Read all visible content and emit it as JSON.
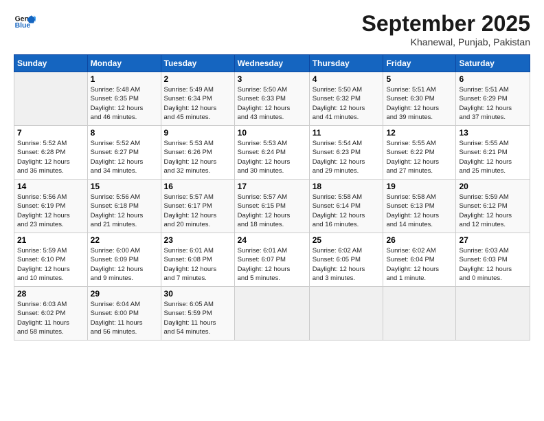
{
  "logo": {
    "line1": "General",
    "line2": "Blue"
  },
  "title": "September 2025",
  "subtitle": "Khanewal, Punjab, Pakistan",
  "days_header": [
    "Sunday",
    "Monday",
    "Tuesday",
    "Wednesday",
    "Thursday",
    "Friday",
    "Saturday"
  ],
  "weeks": [
    [
      {
        "day": "",
        "info": ""
      },
      {
        "day": "1",
        "info": "Sunrise: 5:48 AM\nSunset: 6:35 PM\nDaylight: 12 hours\nand 46 minutes."
      },
      {
        "day": "2",
        "info": "Sunrise: 5:49 AM\nSunset: 6:34 PM\nDaylight: 12 hours\nand 45 minutes."
      },
      {
        "day": "3",
        "info": "Sunrise: 5:50 AM\nSunset: 6:33 PM\nDaylight: 12 hours\nand 43 minutes."
      },
      {
        "day": "4",
        "info": "Sunrise: 5:50 AM\nSunset: 6:32 PM\nDaylight: 12 hours\nand 41 minutes."
      },
      {
        "day": "5",
        "info": "Sunrise: 5:51 AM\nSunset: 6:30 PM\nDaylight: 12 hours\nand 39 minutes."
      },
      {
        "day": "6",
        "info": "Sunrise: 5:51 AM\nSunset: 6:29 PM\nDaylight: 12 hours\nand 37 minutes."
      }
    ],
    [
      {
        "day": "7",
        "info": "Sunrise: 5:52 AM\nSunset: 6:28 PM\nDaylight: 12 hours\nand 36 minutes."
      },
      {
        "day": "8",
        "info": "Sunrise: 5:52 AM\nSunset: 6:27 PM\nDaylight: 12 hours\nand 34 minutes."
      },
      {
        "day": "9",
        "info": "Sunrise: 5:53 AM\nSunset: 6:26 PM\nDaylight: 12 hours\nand 32 minutes."
      },
      {
        "day": "10",
        "info": "Sunrise: 5:53 AM\nSunset: 6:24 PM\nDaylight: 12 hours\nand 30 minutes."
      },
      {
        "day": "11",
        "info": "Sunrise: 5:54 AM\nSunset: 6:23 PM\nDaylight: 12 hours\nand 29 minutes."
      },
      {
        "day": "12",
        "info": "Sunrise: 5:55 AM\nSunset: 6:22 PM\nDaylight: 12 hours\nand 27 minutes."
      },
      {
        "day": "13",
        "info": "Sunrise: 5:55 AM\nSunset: 6:21 PM\nDaylight: 12 hours\nand 25 minutes."
      }
    ],
    [
      {
        "day": "14",
        "info": "Sunrise: 5:56 AM\nSunset: 6:19 PM\nDaylight: 12 hours\nand 23 minutes."
      },
      {
        "day": "15",
        "info": "Sunrise: 5:56 AM\nSunset: 6:18 PM\nDaylight: 12 hours\nand 21 minutes."
      },
      {
        "day": "16",
        "info": "Sunrise: 5:57 AM\nSunset: 6:17 PM\nDaylight: 12 hours\nand 20 minutes."
      },
      {
        "day": "17",
        "info": "Sunrise: 5:57 AM\nSunset: 6:15 PM\nDaylight: 12 hours\nand 18 minutes."
      },
      {
        "day": "18",
        "info": "Sunrise: 5:58 AM\nSunset: 6:14 PM\nDaylight: 12 hours\nand 16 minutes."
      },
      {
        "day": "19",
        "info": "Sunrise: 5:58 AM\nSunset: 6:13 PM\nDaylight: 12 hours\nand 14 minutes."
      },
      {
        "day": "20",
        "info": "Sunrise: 5:59 AM\nSunset: 6:12 PM\nDaylight: 12 hours\nand 12 minutes."
      }
    ],
    [
      {
        "day": "21",
        "info": "Sunrise: 5:59 AM\nSunset: 6:10 PM\nDaylight: 12 hours\nand 10 minutes."
      },
      {
        "day": "22",
        "info": "Sunrise: 6:00 AM\nSunset: 6:09 PM\nDaylight: 12 hours\nand 9 minutes."
      },
      {
        "day": "23",
        "info": "Sunrise: 6:01 AM\nSunset: 6:08 PM\nDaylight: 12 hours\nand 7 minutes."
      },
      {
        "day": "24",
        "info": "Sunrise: 6:01 AM\nSunset: 6:07 PM\nDaylight: 12 hours\nand 5 minutes."
      },
      {
        "day": "25",
        "info": "Sunrise: 6:02 AM\nSunset: 6:05 PM\nDaylight: 12 hours\nand 3 minutes."
      },
      {
        "day": "26",
        "info": "Sunrise: 6:02 AM\nSunset: 6:04 PM\nDaylight: 12 hours\nand 1 minute."
      },
      {
        "day": "27",
        "info": "Sunrise: 6:03 AM\nSunset: 6:03 PM\nDaylight: 12 hours\nand 0 minutes."
      }
    ],
    [
      {
        "day": "28",
        "info": "Sunrise: 6:03 AM\nSunset: 6:02 PM\nDaylight: 11 hours\nand 58 minutes."
      },
      {
        "day": "29",
        "info": "Sunrise: 6:04 AM\nSunset: 6:00 PM\nDaylight: 11 hours\nand 56 minutes."
      },
      {
        "day": "30",
        "info": "Sunrise: 6:05 AM\nSunset: 5:59 PM\nDaylight: 11 hours\nand 54 minutes."
      },
      {
        "day": "",
        "info": ""
      },
      {
        "day": "",
        "info": ""
      },
      {
        "day": "",
        "info": ""
      },
      {
        "day": "",
        "info": ""
      }
    ]
  ]
}
